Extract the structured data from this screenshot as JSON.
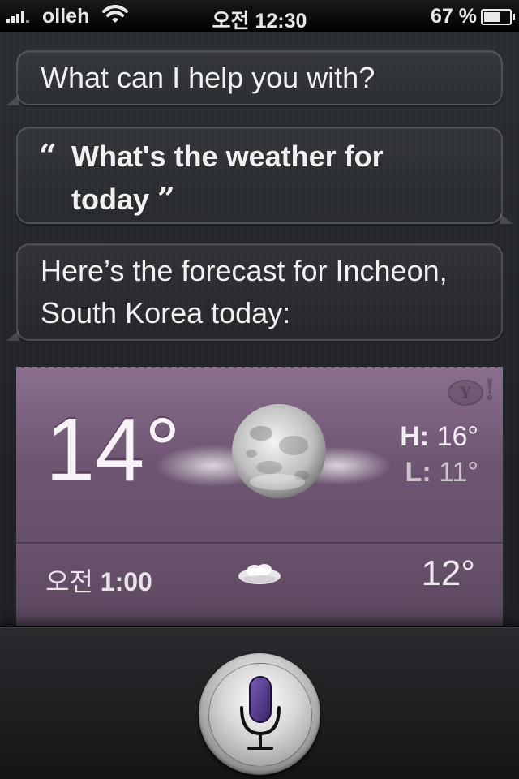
{
  "status_bar": {
    "carrier": "olleh",
    "time": "오전 12:30",
    "battery_percent": "67 %",
    "battery_level": 0.67,
    "signal_icon": "signal-bars-icon",
    "wifi_icon": "wifi-icon",
    "battery_icon": "battery-icon"
  },
  "conversation": {
    "prompt": "What can I help you with?",
    "user_query_line1": "What's the weather for",
    "user_query_line2": "today",
    "open_quote": "“",
    "close_quote": "”",
    "response_line1": "Here’s the forecast for Incheon,",
    "response_line2": "South Korea today:"
  },
  "weather": {
    "current_temp": "14°",
    "condition_icon": "moon-clouds-icon",
    "high_label": "H:",
    "high_value": "16°",
    "low_label": "L:",
    "low_value": "11°",
    "provider_icon": "yahoo-logo-icon",
    "hourly": [
      {
        "period": "오전",
        "time": "1:00",
        "icon": "cloud-icon",
        "temp": "12°"
      }
    ],
    "colors": {
      "card_top": "#8a6f8e",
      "card_bottom": "#5c485f"
    }
  },
  "bottom_bar": {
    "mic_icon": "microphone-icon",
    "mic_color": "#4a2d80"
  }
}
